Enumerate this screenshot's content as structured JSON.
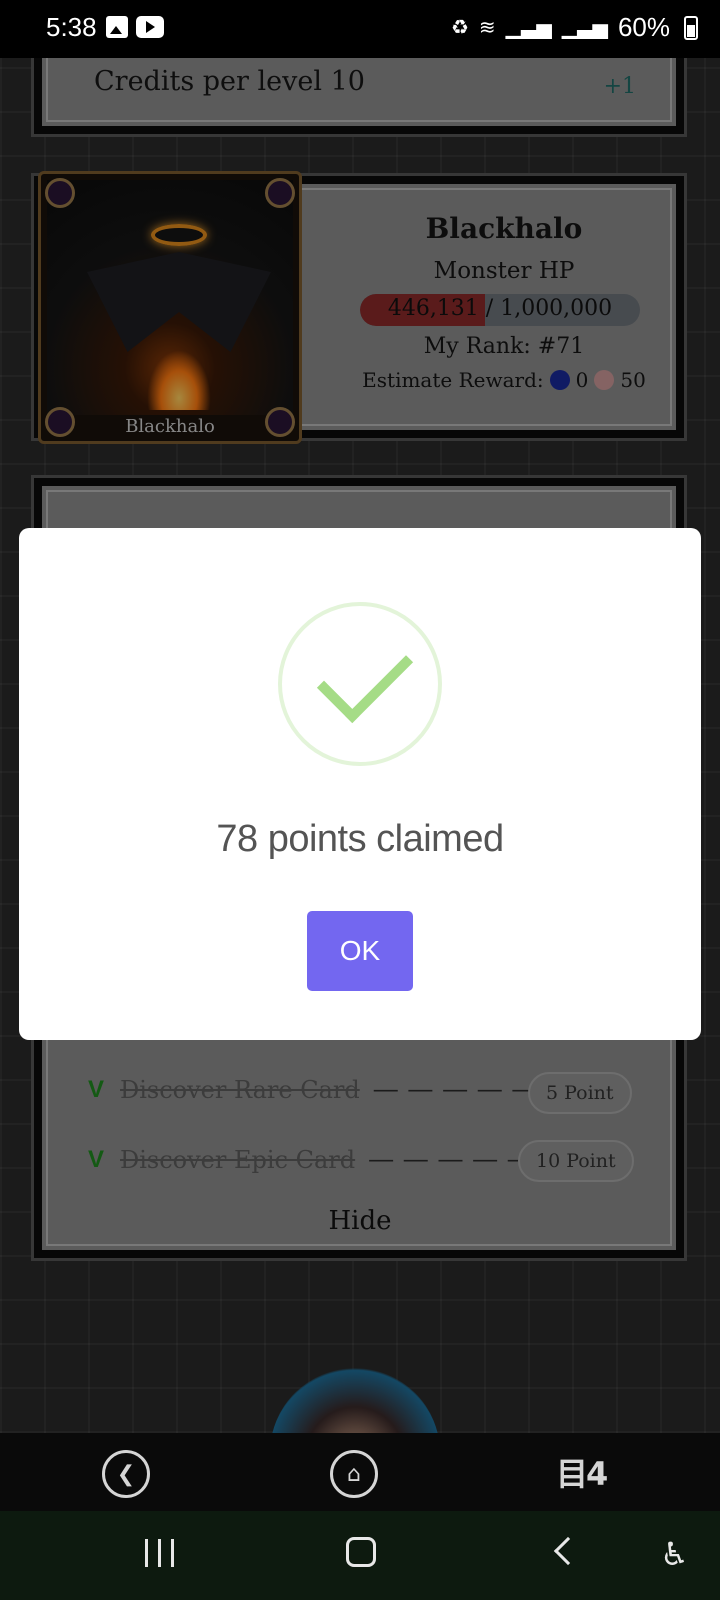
{
  "status_bar": {
    "time": "5:38",
    "battery": "60%",
    "icons": [
      "image-icon",
      "youtube-icon",
      "recycle-icon",
      "wifi-icon",
      "signal-icon",
      "signal-icon",
      "battery-icon"
    ]
  },
  "credits": {
    "label": "Credits per level 10",
    "value": "+1"
  },
  "boss": {
    "card_label": "Blackhalo",
    "name": "Blackhalo",
    "hp_label": "Monster HP",
    "hp_current": "446,131",
    "hp_max": "1,000,000",
    "hp_text": "446,131 / 1,000,000",
    "hp_fraction": 0.446,
    "rank": "My Rank: #71",
    "reward_label": "Estimate Reward:",
    "reward_coin": "0",
    "reward_skull": "50"
  },
  "quests": {
    "rows": [
      {
        "label": "Discover Rare Card",
        "dashes": "— — — — —",
        "points": "5 Point",
        "done": "V"
      },
      {
        "label": "Discover Epic Card",
        "dashes": "— — — — —",
        "points": "10 Point",
        "done": "V"
      }
    ],
    "hide_label": "Hide"
  },
  "modal": {
    "title": "78 points claimed",
    "ok_label": "OK",
    "icon": "success-check-icon",
    "accent": "#a5dc86",
    "button_color": "#7367f0"
  },
  "app_nav": {
    "back_icon": "back-arrow-icon",
    "home_icon": "home-icon",
    "brand": "目4"
  },
  "system_nav": {
    "recents_icon": "recents-icon",
    "home_icon": "home-square-icon",
    "back_icon": "back-chevron-icon",
    "accessibility_icon": "accessibility-icon",
    "accessibility_glyph": "♿"
  }
}
